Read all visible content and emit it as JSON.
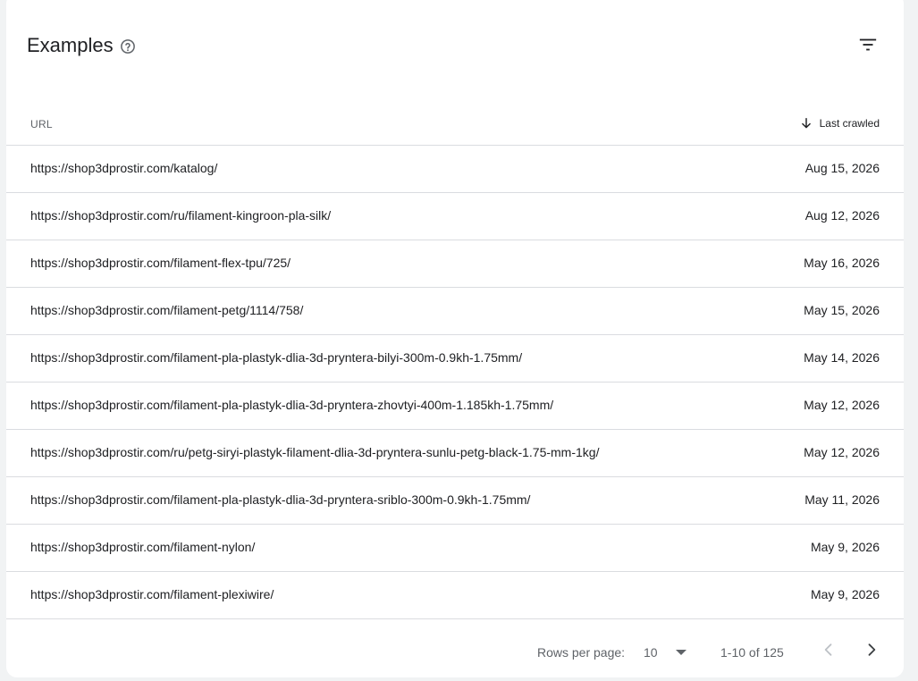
{
  "header": {
    "title": "Examples"
  },
  "table": {
    "columns": {
      "url": "URL",
      "last_crawled": "Last crawled"
    },
    "rows": [
      {
        "url": "https://shop3dprostir.com/katalog/",
        "date": "Aug 15, 2026"
      },
      {
        "url": "https://shop3dprostir.com/ru/filament-kingroon-pla-silk/",
        "date": "Aug 12, 2026"
      },
      {
        "url": "https://shop3dprostir.com/filament-flex-tpu/725/",
        "date": "May 16, 2026"
      },
      {
        "url": "https://shop3dprostir.com/filament-petg/1114/758/",
        "date": "May 15, 2026"
      },
      {
        "url": "https://shop3dprostir.com/filament-pla-plastyk-dlia-3d-pryntera-bilyi-300m-0.9kh-1.75mm/",
        "date": "May 14, 2026"
      },
      {
        "url": "https://shop3dprostir.com/filament-pla-plastyk-dlia-3d-pryntera-zhovtyi-400m-1.185kh-1.75mm/",
        "date": "May 12, 2026"
      },
      {
        "url": "https://shop3dprostir.com/ru/petg-siryi-plastyk-filament-dlia-3d-pryntera-sunlu-petg-black-1.75-mm-1kg/",
        "date": "May 12, 2026"
      },
      {
        "url": "https://shop3dprostir.com/filament-pla-plastyk-dlia-3d-pryntera-sriblo-300m-0.9kh-1.75mm/",
        "date": "May 11, 2026"
      },
      {
        "url": "https://shop3dprostir.com/filament-nylon/",
        "date": "May 9, 2026"
      },
      {
        "url": "https://shop3dprostir.com/filament-plexiwire/",
        "date": "May 9, 2026"
      }
    ]
  },
  "pagination": {
    "rows_per_page_label": "Rows per page:",
    "rows_per_page_value": "10",
    "range": "1-10 of 125"
  },
  "icons": {
    "help": "help-circle-icon",
    "filter": "filter-icon",
    "sort": "arrow-down-icon",
    "dropdown": "dropdown-triangle-icon",
    "prev": "chevron-left-icon",
    "next": "chevron-right-icon"
  },
  "colors": {
    "text": "#202124",
    "muted": "#5f6368",
    "divider": "#dadce0",
    "background": "#f1f3f4"
  }
}
